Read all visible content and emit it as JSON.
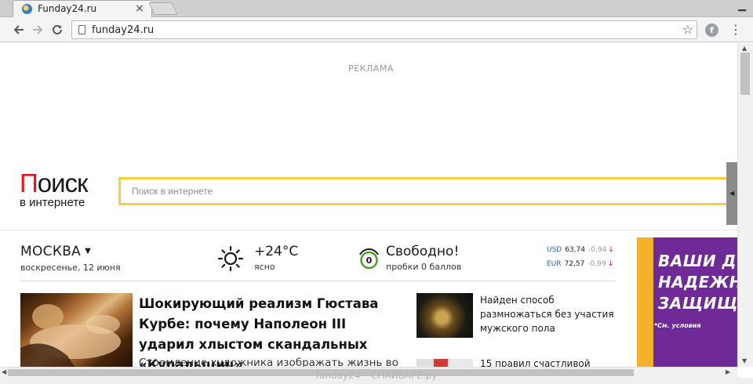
{
  "browser": {
    "tab_title": "Funday24.ru",
    "tab_close": "×",
    "url": "funday24.ru"
  },
  "page": {
    "ad_label": "РЕКЛАМА",
    "logo": {
      "first_letter": "П",
      "rest": "оиск",
      "subtitle": "в интернете"
    },
    "search": {
      "placeholder": "Поиск в интернете"
    },
    "city": {
      "name": "МОСКВА",
      "date": "воскресенье, 12 июня"
    },
    "weather": {
      "temp": "+24°C",
      "desc": "ясно"
    },
    "traffic": {
      "score": "0",
      "title": "Свободно!",
      "desc": "пробки 0 баллов"
    },
    "rates": [
      {
        "currency": "USD",
        "value": "63,74",
        "change": "-0,94",
        "arrow": "↓"
      },
      {
        "currency": "EUR",
        "value": "72,57",
        "change": "-0,99",
        "arrow": "↓"
      }
    ],
    "banner": {
      "lines": [
        "ВАШИ Д",
        "НАДЕЖН",
        "ЗАЩИЩЕ"
      ],
      "note": "*См. условия"
    },
    "lead_news": {
      "title": "Шокирующий реализм Гюстава Курбе: почему Наполеон III ударил хлыстом скандальных «Купальщиц»",
      "snippet": "Стремление художника изображать жизнь во"
    },
    "side_news": [
      {
        "title": "Найден способ размножаться без участия мужского пола"
      },
      {
        "title": "15 правил счастливой"
      }
    ],
    "watermark": "funday24 – СПАЙВАРЕ.ру"
  },
  "colors": {
    "logo_red": "#e3131b",
    "search_border": "#f5cd42",
    "banner_bg": "#6f2a97",
    "banner_strip": "#f6b12c",
    "currency_blue": "#3560a6",
    "traffic_green": "#4a9a2a"
  },
  "icons": {
    "back": "arrow-left-icon",
    "forward": "arrow-right-icon",
    "reload": "reload-icon",
    "bookmark": "star-icon",
    "menu": "kebab-menu-icon"
  }
}
